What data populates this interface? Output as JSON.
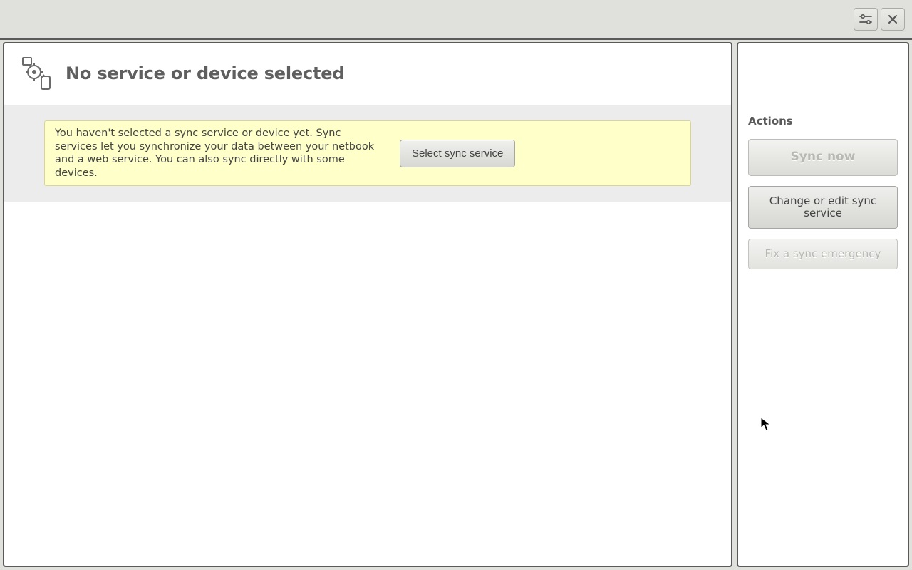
{
  "main": {
    "title": "No service or device selected",
    "info_text": "You haven't selected a sync service or device yet. Sync services let you synchronize your data between your netbook and a web service. You can also sync directly with some devices.",
    "select_button": "Select sync service"
  },
  "sidebar": {
    "title": "Actions",
    "sync_now": "Sync now",
    "change_service": "Change or edit sync service",
    "fix_emergency": "Fix a sync emergency"
  }
}
